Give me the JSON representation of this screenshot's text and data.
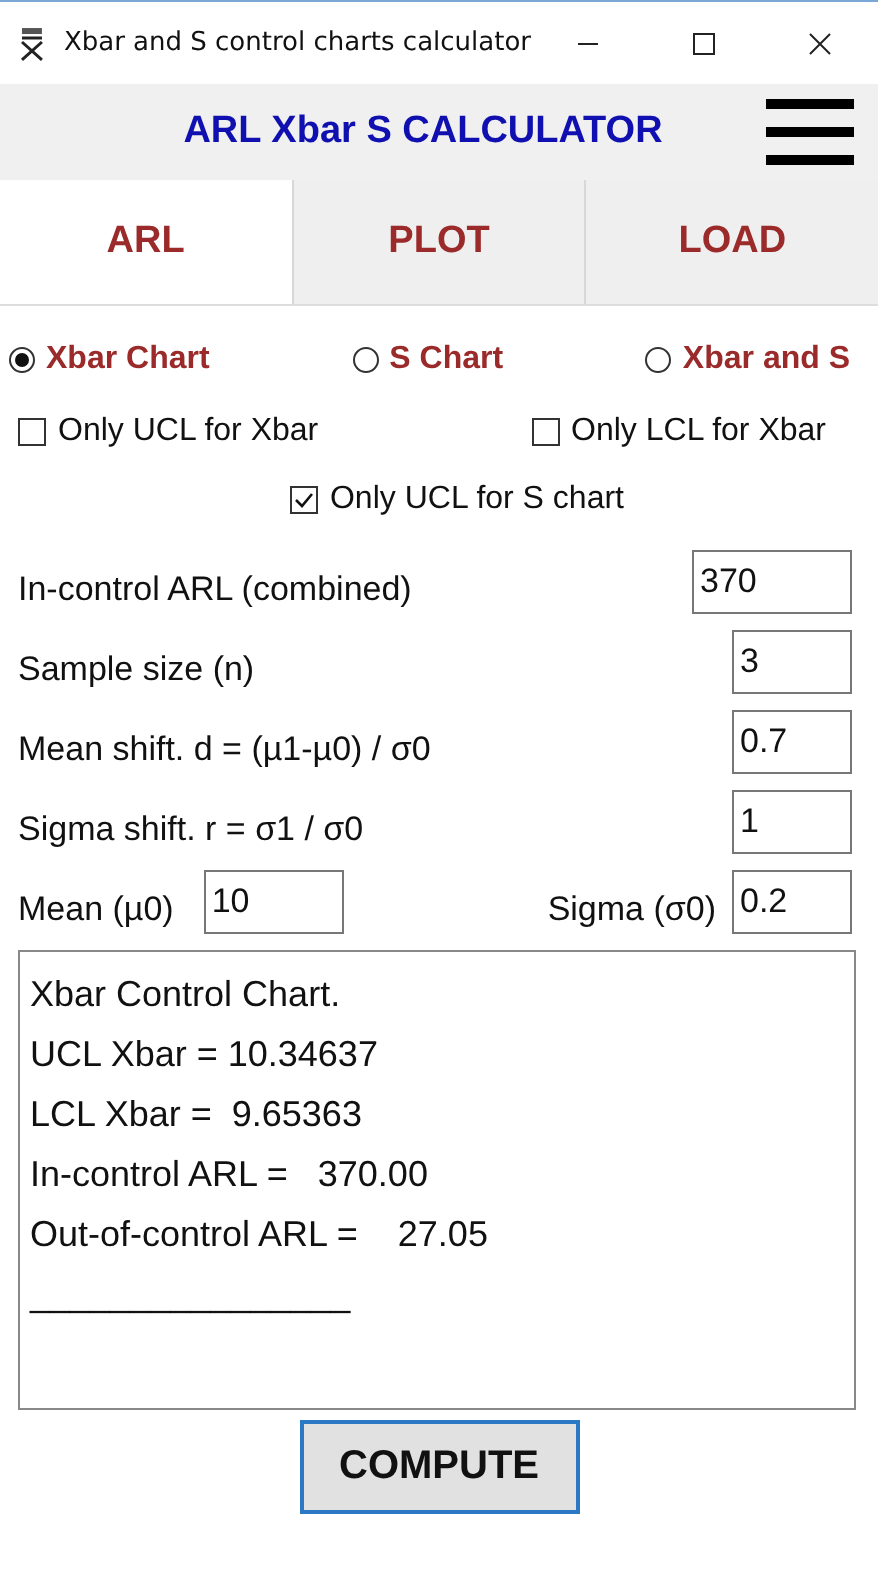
{
  "window": {
    "title": "Xbar and S control charts calculator"
  },
  "header": {
    "title": "ARL Xbar S CALCULATOR"
  },
  "tabs": [
    {
      "label": "ARL",
      "selected": true
    },
    {
      "label": "PLOT",
      "selected": false
    },
    {
      "label": "LOAD",
      "selected": false
    }
  ],
  "chart_types": [
    {
      "label": "Xbar Chart",
      "selected": true
    },
    {
      "label": "S Chart",
      "selected": false
    },
    {
      "label": "Xbar and S",
      "selected": false
    }
  ],
  "options": [
    {
      "label": "Only UCL for Xbar",
      "checked": false
    },
    {
      "label": "Only LCL for Xbar",
      "checked": false
    },
    {
      "label": "Only UCL for S chart",
      "checked": true
    }
  ],
  "fields": [
    {
      "label": "In-control ARL (combined)",
      "value": "370"
    },
    {
      "label": "Sample size (n)",
      "value": "3"
    },
    {
      "label": "Mean shift. d = (µ1-µ0) / σ0",
      "value": "0.7"
    },
    {
      "label": "Sigma shift. r = σ1 / σ0",
      "value": "1"
    }
  ],
  "bottom_fields": [
    {
      "label": "Mean (µ0)",
      "value": "10"
    },
    {
      "label": "Sigma (σ0)",
      "value": "0.2"
    }
  ],
  "output": [
    "Xbar Control Chart.",
    "UCL Xbar = 10.34637",
    "LCL Xbar =  9.65363",
    "In-control ARL =   370.00",
    "Out-of-control ARL =    27.05",
    "________________"
  ],
  "compute_button": "COMPUTE"
}
